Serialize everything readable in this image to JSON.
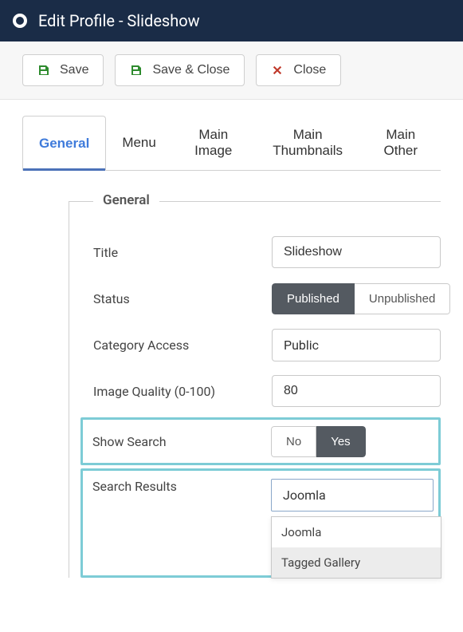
{
  "header": {
    "title": "Edit Profile - Slideshow"
  },
  "toolbar": {
    "save_label": "Save",
    "save_close_label": "Save & Close",
    "close_label": "Close"
  },
  "tabs": [
    {
      "id": "general",
      "label": "General",
      "active": true
    },
    {
      "id": "menu",
      "label": "Menu",
      "active": false
    },
    {
      "id": "main_image",
      "label": "Main Image",
      "active": false
    },
    {
      "id": "main_thumbnails",
      "label": "Main Thumbnails",
      "active": false
    },
    {
      "id": "main_other",
      "label": "Main Other",
      "active": false
    }
  ],
  "section": {
    "legend": "General"
  },
  "fields": {
    "title": {
      "label": "Title",
      "value": "Slideshow"
    },
    "status": {
      "label": "Status",
      "options": [
        "Published",
        "Unpublished"
      ],
      "value": "Published"
    },
    "category_access": {
      "label": "Category Access",
      "value": "Public"
    },
    "image_quality": {
      "label": "Image Quality (0-100)",
      "value": "80"
    },
    "show_search": {
      "label": "Show Search",
      "options": [
        "No",
        "Yes"
      ],
      "value": "Yes"
    },
    "search_results": {
      "label": "Search Results",
      "value": "Joomla",
      "options": [
        "Joomla",
        "Tagged Gallery"
      ],
      "highlighted_option_index": 1
    }
  }
}
